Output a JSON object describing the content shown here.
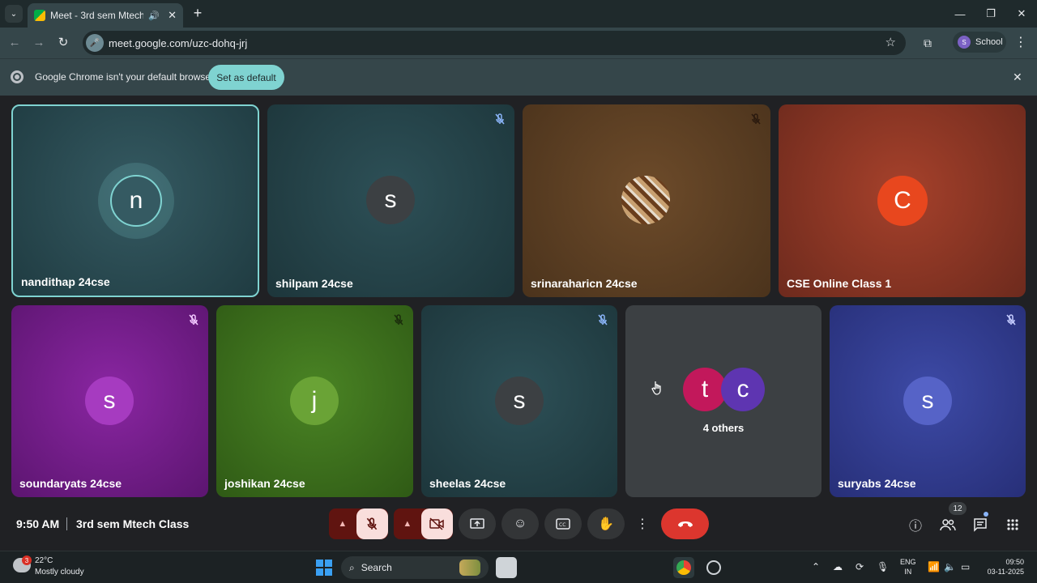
{
  "browser": {
    "tab_title": "Meet - 3rd sem Mtech Class",
    "url": "meet.google.com/uzc-dohq-jrj",
    "profile_initial": "S",
    "profile_name": "School",
    "infobar_message": "Google Chrome isn't your default browser",
    "set_default_label": "Set as default"
  },
  "tiles": [
    {
      "name": "nandithap 24cse",
      "initial": "n",
      "avatar_color": "#355a62",
      "muted": false,
      "speaking": true
    },
    {
      "name": "shilpam 24cse",
      "initial": "s",
      "avatar_color": "#3c4043",
      "muted": true
    },
    {
      "name": "srinaraharicn 24cse",
      "initial": "",
      "avatar_color": "#8b5a2b",
      "muted": true,
      "photo": true
    },
    {
      "name": "CSE Online Class 1",
      "initial": "C",
      "avatar_color": "#e8471e",
      "muted": false
    },
    {
      "name": "soundaryats 24cse",
      "initial": "s",
      "avatar_color": "#a63bc0",
      "muted": true
    },
    {
      "name": "joshikan 24cse",
      "initial": "j",
      "avatar_color": "#6aa336",
      "muted": true
    },
    {
      "name": "sheelas 24cse",
      "initial": "s",
      "avatar_color": "#3c4043",
      "muted": true
    },
    {
      "name": "suryabs 24cse",
      "initial": "s",
      "avatar_color": "#5663c7",
      "muted": true
    }
  ],
  "others": {
    "label": "4 others",
    "avatars": [
      {
        "initial": "t",
        "color": "#c2185b"
      },
      {
        "initial": "c",
        "color": "#5e35b1"
      }
    ]
  },
  "meeting": {
    "time": "9:50 AM",
    "name": "3rd sem Mtech Class",
    "people_count": "12"
  },
  "taskbar": {
    "weather_badge": "3",
    "temperature": "22°C",
    "condition": "Mostly cloudy",
    "search_label": "Search",
    "lang_top": "ENG",
    "lang_bottom": "IN",
    "time": "09:50",
    "date": "03-11-2025"
  }
}
